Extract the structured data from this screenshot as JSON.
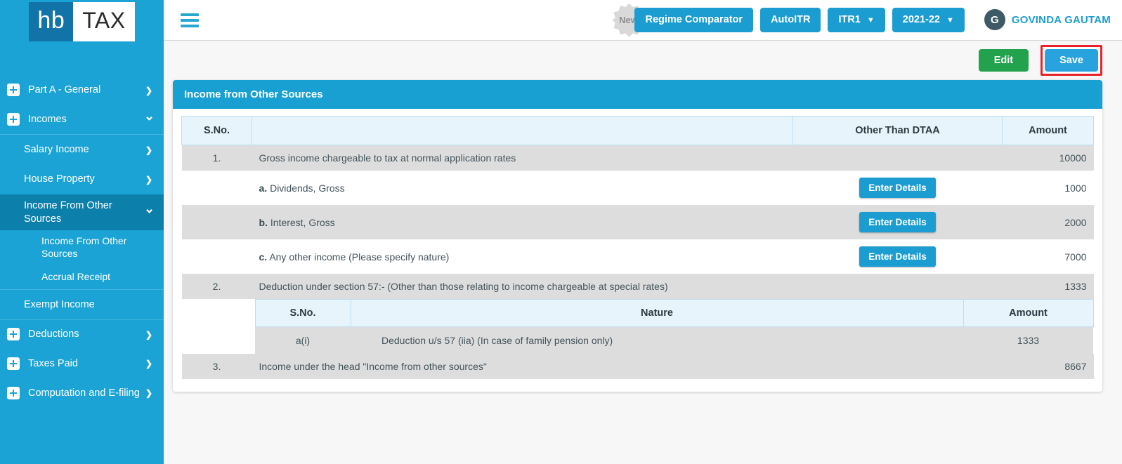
{
  "brand": {
    "mark": "hb",
    "name": "TAX"
  },
  "sidebar": {
    "items": [
      {
        "label": "Part A - General",
        "level": 1,
        "icon": "plus-box-icon",
        "chevron": "chevron-right-icon",
        "active": false
      },
      {
        "label": "Incomes",
        "level": 1,
        "icon": "plus-box-icon",
        "chevron": "chevron-down-icon",
        "active": false
      },
      {
        "label": "Salary Income",
        "level": 2,
        "icon": "",
        "chevron": "chevron-right-icon",
        "active": false
      },
      {
        "label": "House Property",
        "level": 2,
        "icon": "",
        "chevron": "chevron-right-icon",
        "active": false
      },
      {
        "label": "Income From Other Sources",
        "level": 2,
        "icon": "",
        "chevron": "chevron-down-icon",
        "active": true
      },
      {
        "label": "Income From Other Sources",
        "level": 3,
        "icon": "",
        "chevron": "",
        "active": false
      },
      {
        "label": "Accrual Receipt",
        "level": 3,
        "icon": "",
        "chevron": "",
        "active": false
      },
      {
        "label": "Exempt Income",
        "level": 2,
        "icon": "",
        "chevron": "",
        "active": false
      },
      {
        "label": "Deductions",
        "level": 1,
        "icon": "plus-box-icon",
        "chevron": "chevron-right-icon",
        "active": false
      },
      {
        "label": "Taxes Paid",
        "level": 1,
        "icon": "plus-box-icon",
        "chevron": "chevron-right-icon",
        "active": false
      },
      {
        "label": "Computation and E-filing",
        "level": 1,
        "icon": "plus-box-icon",
        "chevron": "chevron-right-icon",
        "active": false
      }
    ]
  },
  "topbar": {
    "menu_icon": "hamburger-icon",
    "new_badge": "New",
    "regime_comparator": "Regime Comparator",
    "auto_itr": "AutoITR",
    "itr_form": "ITR1",
    "assessment_year": "2021-22",
    "chevron": "⌄",
    "user_initial": "G",
    "user_name": "GOVINDA GAUTAM"
  },
  "actions": {
    "edit": "Edit",
    "save": "Save"
  },
  "card": {
    "title": "Income from Other Sources",
    "columns": {
      "sno": "S.No.",
      "desc": "",
      "dtaa": "Other Than DTAA",
      "amount": "Amount"
    },
    "rows": [
      {
        "sno": "1.",
        "letter": "",
        "desc": "Gross income chargeable to tax at normal application rates",
        "dtaa": "",
        "amount": "10000",
        "shade": true,
        "indent": false
      },
      {
        "sno": "",
        "letter": "a.",
        "desc": "Dividends, Gross",
        "dtaa": "Enter Details",
        "amount": "1000",
        "shade": false,
        "indent": true
      },
      {
        "sno": "",
        "letter": "b.",
        "desc": "Interest, Gross",
        "dtaa": "Enter Details",
        "amount": "2000",
        "shade": true,
        "indent": true
      },
      {
        "sno": "",
        "letter": "c.",
        "desc": "Any other income (Please specify nature)",
        "dtaa": "Enter Details",
        "amount": "7000",
        "shade": false,
        "indent": true
      },
      {
        "sno": "2.",
        "letter": "",
        "desc": "Deduction under section 57:- (Other than those relating to income chargeable at special rates)",
        "dtaa": "",
        "amount": "1333",
        "shade": true,
        "indent": false
      }
    ],
    "nested": {
      "columns": {
        "sno": "S.No.",
        "nature": "Nature",
        "amount": "Amount"
      },
      "rows": [
        {
          "sno": "a(i)",
          "nature": "Deduction u/s 57 (iia) (In case of family pension only)",
          "amount": "1333"
        }
      ]
    },
    "final_row": {
      "sno": "3.",
      "desc": "Income under the head \"Income from other sources\"",
      "amount": "8667"
    }
  },
  "colors": {
    "brand_blue": "#1aa3d4",
    "sidebar_active": "#0d7fab",
    "save_blue": "#29a3dd",
    "edit_green": "#23a24d",
    "highlight_red": "#e8232a",
    "table_header": "#e8f4fc",
    "row_shade": "#dddddd"
  }
}
